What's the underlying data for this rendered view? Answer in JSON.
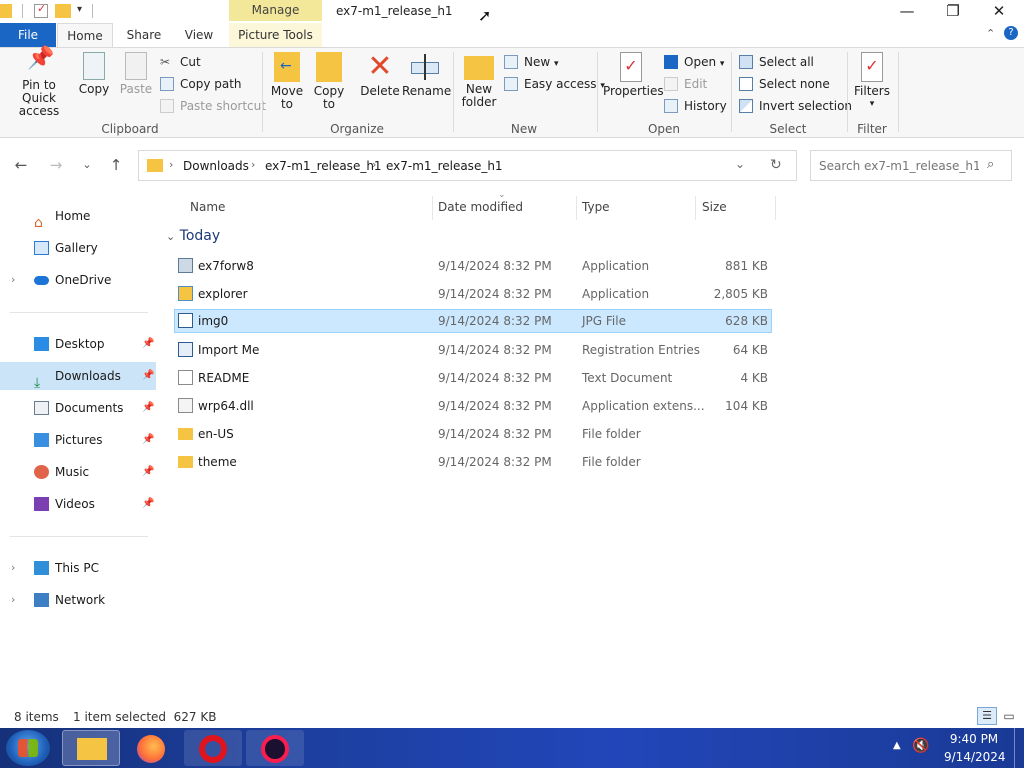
{
  "window": {
    "title": "ex7-m1_release_h1",
    "context_tab_group": "Manage",
    "controls": {
      "minimize": "—",
      "maximize": "❐",
      "close": "✕"
    }
  },
  "ribbon_tabs": [
    "File",
    "Home",
    "Share",
    "View",
    "Picture Tools"
  ],
  "ribbon": {
    "clipboard": {
      "label": "Clipboard",
      "pin": "Pin to Quick access",
      "copy": "Copy",
      "paste": "Paste",
      "cut": "Cut",
      "copy_path": "Copy path",
      "paste_shortcut": "Paste shortcut"
    },
    "organize": {
      "label": "Organize",
      "move_to": "Move to",
      "copy_to": "Copy to",
      "delete": "Delete",
      "rename": "Rename"
    },
    "new": {
      "label": "New",
      "new_folder": "New folder",
      "new_item": "New",
      "easy_access": "Easy access"
    },
    "open": {
      "label": "Open",
      "properties": "Properties",
      "open": "Open",
      "edit": "Edit",
      "history": "History"
    },
    "select": {
      "label": "Select",
      "select_all": "Select all",
      "select_none": "Select none",
      "invert": "Invert selection"
    },
    "filter": {
      "label": "Filter",
      "filters": "Filters"
    }
  },
  "address": {
    "crumbs": [
      "Downloads",
      "ex7-m1_release_h1",
      "ex7-m1_release_h1"
    ],
    "search_placeholder": "Search ex7-m1_release_h1"
  },
  "nav": {
    "items": [
      {
        "label": "Home",
        "icon": "home-icon"
      },
      {
        "label": "Gallery",
        "icon": "gallery-icon"
      },
      {
        "label": "OneDrive",
        "icon": "cloud-icon"
      },
      {
        "label": "Desktop",
        "icon": "desktop-icon"
      },
      {
        "label": "Downloads",
        "icon": "download-icon"
      },
      {
        "label": "Documents",
        "icon": "documents-icon"
      },
      {
        "label": "Pictures",
        "icon": "pictures-icon"
      },
      {
        "label": "Music",
        "icon": "music-icon"
      },
      {
        "label": "Videos",
        "icon": "videos-icon"
      },
      {
        "label": "This PC",
        "icon": "computer-icon"
      },
      {
        "label": "Network",
        "icon": "network-icon"
      }
    ]
  },
  "list": {
    "columns": [
      "Name",
      "Date modified",
      "Type",
      "Size"
    ],
    "group": "Today",
    "rows": [
      {
        "name": "ex7forw8",
        "date": "9/14/2024 8:32 PM",
        "type": "Application",
        "size": "881 KB",
        "icon": "app-icon"
      },
      {
        "name": "explorer",
        "date": "9/14/2024 8:32 PM",
        "type": "Application",
        "size": "2,805 KB",
        "icon": "explorer-app-icon"
      },
      {
        "name": "img0",
        "date": "9/14/2024 8:32 PM",
        "type": "JPG File",
        "size": "628 KB",
        "icon": "image-file-icon"
      },
      {
        "name": "Import Me",
        "date": "9/14/2024 8:32 PM",
        "type": "Registration Entries",
        "size": "64 KB",
        "icon": "registry-file-icon"
      },
      {
        "name": "README",
        "date": "9/14/2024 8:32 PM",
        "type": "Text Document",
        "size": "4 KB",
        "icon": "text-file-icon"
      },
      {
        "name": "wrp64.dll",
        "date": "9/14/2024 8:32 PM",
        "type": "Application extens...",
        "size": "104 KB",
        "icon": "dll-file-icon"
      },
      {
        "name": "en-US",
        "date": "9/14/2024 8:32 PM",
        "type": "File folder",
        "size": "",
        "icon": "folder-icon"
      },
      {
        "name": "theme",
        "date": "9/14/2024 8:32 PM",
        "type": "File folder",
        "size": "",
        "icon": "folder-icon"
      }
    ]
  },
  "status": {
    "count": "8 items",
    "selection": "1 item selected  627 KB"
  },
  "taskbar": {
    "time": "9:40 PM",
    "date": "9/14/2024"
  },
  "colors": {
    "accent": "#1a66c4",
    "selection": "#cce8ff",
    "folder": "#f5c443",
    "context_tab": "#f3e89a"
  }
}
